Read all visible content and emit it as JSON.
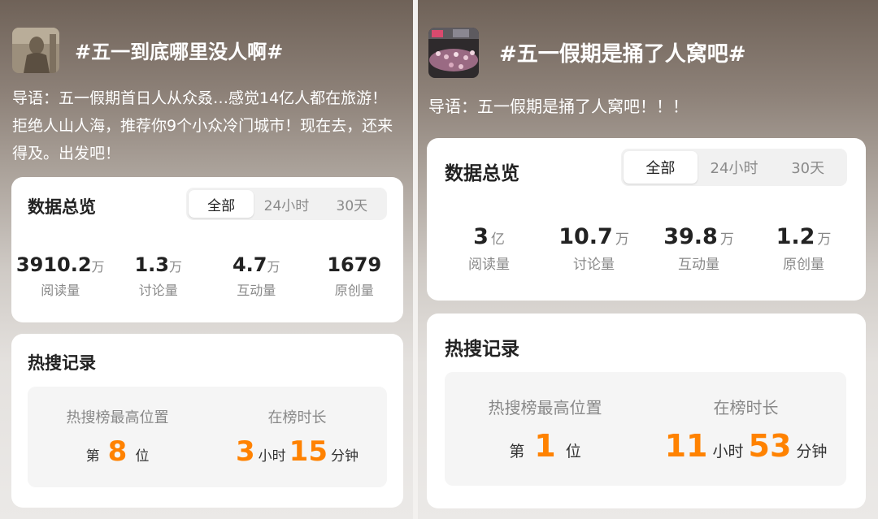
{
  "left": {
    "title": "#五一到底哪里没人啊#",
    "intro": "导语：五一假期首日人从众叒…感觉14亿人都在旅游！拒绝人山人海，推荐你9个小众冷门城市！现在去，还来得及。出发吧！",
    "overview": {
      "title": "数据总览",
      "tabs": [
        "全部",
        "24小时",
        "30天"
      ],
      "stats": [
        {
          "value": "3910.2",
          "unit": "万",
          "label": "阅读量"
        },
        {
          "value": "1.3",
          "unit": "万",
          "label": "讨论量"
        },
        {
          "value": "4.7",
          "unit": "万",
          "label": "互动量"
        },
        {
          "value": "1679",
          "unit": "",
          "label": "原创量"
        }
      ]
    },
    "hot": {
      "title": "热搜记录",
      "rank_label": "热搜榜最高位置",
      "rank_prefix": "第",
      "rank_value": "8",
      "rank_suffix": "位",
      "duration_label": "在榜时长",
      "hours": "3",
      "hours_unit": "小时",
      "minutes": "15",
      "minutes_unit": "分钟"
    }
  },
  "right": {
    "title": "#五一假期是捅了人窝吧#",
    "intro": "导语：五一假期是捅了人窝吧！！！",
    "overview": {
      "title": "数据总览",
      "tabs": [
        "全部",
        "24小时",
        "30天"
      ],
      "stats": [
        {
          "value": "3",
          "unit": "亿",
          "label": "阅读量"
        },
        {
          "value": "10.7",
          "unit": "万",
          "label": "讨论量"
        },
        {
          "value": "39.8",
          "unit": "万",
          "label": "互动量"
        },
        {
          "value": "1.2",
          "unit": "万",
          "label": "原创量"
        }
      ]
    },
    "hot": {
      "title": "热搜记录",
      "rank_label": "热搜榜最高位置",
      "rank_prefix": "第",
      "rank_value": "1",
      "rank_suffix": "位",
      "duration_label": "在榜时长",
      "hours": "11",
      "hours_unit": "小时",
      "minutes": "53",
      "minutes_unit": "分钟"
    }
  },
  "colors": {
    "accent": "#ff8200"
  }
}
